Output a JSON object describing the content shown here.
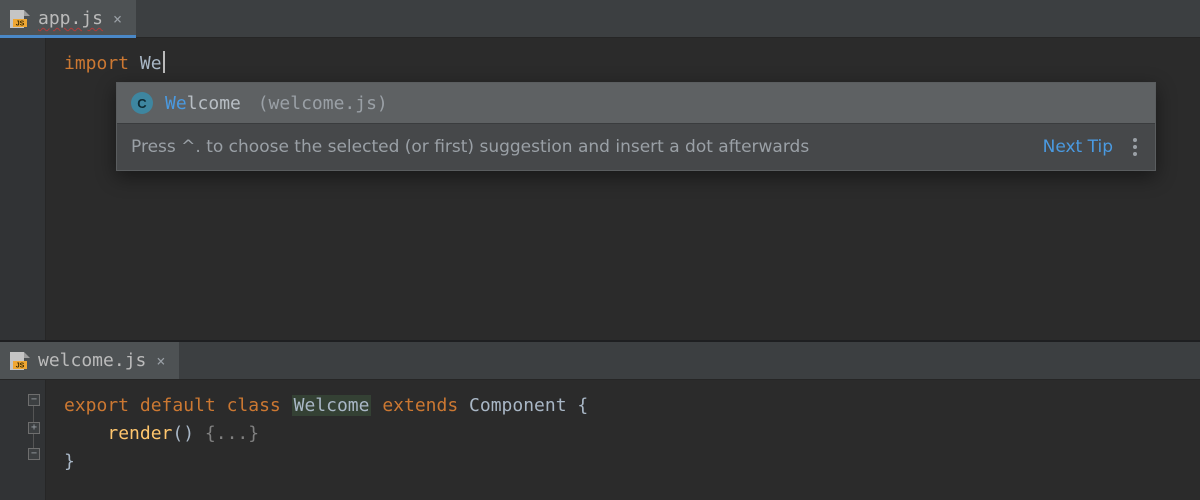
{
  "top": {
    "tab": {
      "filename": "app.js"
    },
    "code": {
      "import_kw": "import",
      "typed": "We"
    },
    "popup": {
      "badge": "C",
      "match": "We",
      "rest": "lcome",
      "tail": "(welcome.js)",
      "hint": "Press ^. to choose the selected (or first) suggestion and insert a dot afterwards",
      "next_tip": "Next Tip"
    }
  },
  "bottom": {
    "tab": {
      "filename": "welcome.js"
    },
    "code": {
      "export_kw": "export",
      "default_kw": "default",
      "class_kw": "class",
      "class_name": "Welcome",
      "extends_kw": "extends",
      "super_name": "Component",
      "render_fn": "render",
      "fold_body": "{...}"
    }
  }
}
